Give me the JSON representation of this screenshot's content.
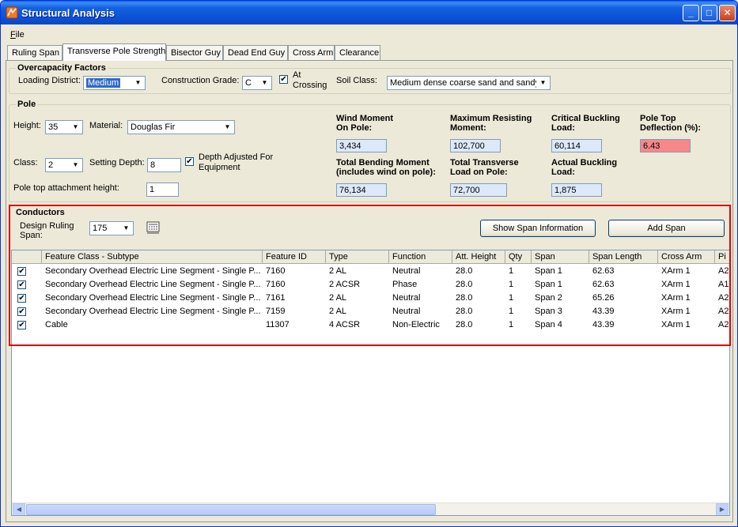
{
  "window": {
    "title": "Structural Analysis",
    "minimize": "_",
    "maximize": "□",
    "close": "✕"
  },
  "menu": {
    "file_first": "F",
    "file_rest": "ile"
  },
  "tabs": [
    "Ruling Span",
    "Transverse Pole Strength",
    "Bisector Guy",
    "Dead End Guy",
    "Cross Arm",
    "Clearance"
  ],
  "overcapacity": {
    "title": "Overcapacity Factors",
    "loading_district_label": "Loading District:",
    "loading_district_value": "Medium",
    "construction_grade_label": "Construction Grade:",
    "construction_grade_value": "C",
    "at_crossing_line1": "At",
    "at_crossing_line2": "Crossing",
    "at_crossing_checked": "✔",
    "soil_class_label": "Soil Class:",
    "soil_class_value": "Medium dense coarse sand and sandy"
  },
  "pole": {
    "title": "Pole",
    "height_label": "Height:",
    "height_value": "35",
    "material_label": "Material:",
    "material_value": "Douglas Fir",
    "class_label": "Class:",
    "class_value": "2",
    "setting_depth_label": "Setting Depth:",
    "setting_depth_value": "8",
    "depth_adjusted_line1": "Depth Adjusted For",
    "depth_adjusted_line2": "Equipment",
    "depth_adjusted_checked": "✔",
    "pole_top_label": "Pole top attachment height:",
    "pole_top_value": "1",
    "wind_moment_label1": "Wind Moment",
    "wind_moment_label2": "On Pole:",
    "wind_moment_value": "3,434",
    "max_resisting_label1": "Maximum Resisting",
    "max_resisting_label2": "Moment:",
    "max_resisting_value": "102,700",
    "critical_buckling_label1": "Critical Buckling",
    "critical_buckling_label2": "Load:",
    "critical_buckling_value": "60,114",
    "pole_top_deflection_label1": "Pole Top",
    "pole_top_deflection_label2": "Deflection (%):",
    "pole_top_deflection_value": "6.43",
    "total_bending_label1": "Total Bending Moment",
    "total_bending_label2": "(includes wind on pole):",
    "total_bending_value": "76,134",
    "total_transverse_label1": "Total Transverse",
    "total_transverse_label2": "Load on Pole:",
    "total_transverse_value": "72,700",
    "actual_buckling_label1": "Actual Buckling",
    "actual_buckling_label2": "Load:",
    "actual_buckling_value": "1,875"
  },
  "conductors": {
    "title": "Conductors",
    "design_ruling_label1": "Design Ruling",
    "design_ruling_label2": "Span:",
    "design_ruling_value": "175",
    "show_span_button": "Show Span Information",
    "add_span_button": "Add Span",
    "columns": [
      "",
      "Feature Class - Subtype",
      "Feature ID",
      "Type",
      "Function",
      "Att. Height",
      "Qty",
      "Span",
      "Span Length",
      "Cross Arm",
      "Pi"
    ],
    "rows": [
      {
        "checked": "✔",
        "feature": "Secondary Overhead Electric Line Segment - Single P...",
        "id": "7160",
        "type": "2 AL",
        "function": "Neutral",
        "height": "28.0",
        "qty": "1",
        "span": "Span 1",
        "length": "62.63",
        "arm": "XArm 1",
        "pi": "A2"
      },
      {
        "checked": "✔",
        "feature": "Secondary Overhead Electric Line Segment - Single P...",
        "id": "7160",
        "type": "2 ACSR",
        "function": "Phase",
        "height": "28.0",
        "qty": "1",
        "span": "Span 1",
        "length": "62.63",
        "arm": "XArm 1",
        "pi": "A1"
      },
      {
        "checked": "✔",
        "feature": "Secondary Overhead Electric Line Segment - Single P...",
        "id": "7161",
        "type": "2 AL",
        "function": "Neutral",
        "height": "28.0",
        "qty": "1",
        "span": "Span 2",
        "length": "65.26",
        "arm": "XArm 1",
        "pi": "A2"
      },
      {
        "checked": "✔",
        "feature": "Secondary Overhead Electric Line Segment - Single P...",
        "id": "7159",
        "type": "2 AL",
        "function": "Neutral",
        "height": "28.0",
        "qty": "1",
        "span": "Span 3",
        "length": "43.39",
        "arm": "XArm 1",
        "pi": "A2"
      },
      {
        "checked": "✔",
        "feature": "Cable",
        "id": "11307",
        "type": "4 ACSR",
        "function": "Non-Electric",
        "height": "28.0",
        "qty": "1",
        "span": "Span 4",
        "length": "43.39",
        "arm": "XArm 1",
        "pi": "A2"
      }
    ]
  },
  "colors": {
    "title_bar": "#0b52d6",
    "readout_bg": "#dde8f8",
    "alert_bg": "#f8878a",
    "highlight": "#e00000"
  }
}
